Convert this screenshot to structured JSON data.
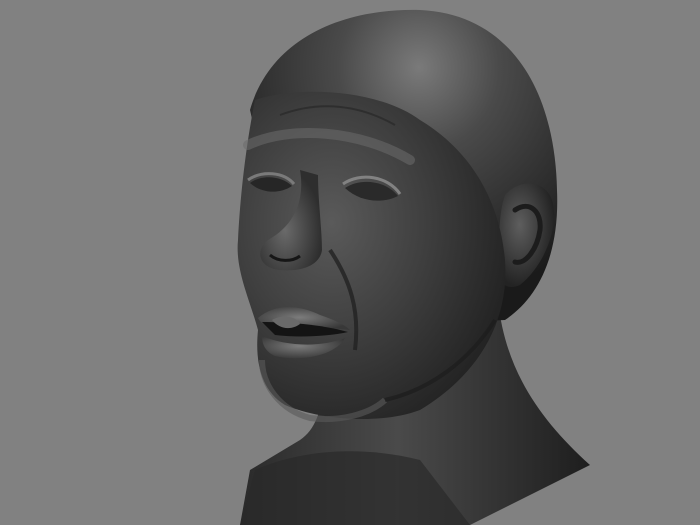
{
  "scene": {
    "subject": "sculpted-head-render",
    "background_color": "#818181",
    "material_color": "#3c3c3c",
    "highlight_color": "#8a8a8a",
    "shadow_color": "#161616"
  }
}
